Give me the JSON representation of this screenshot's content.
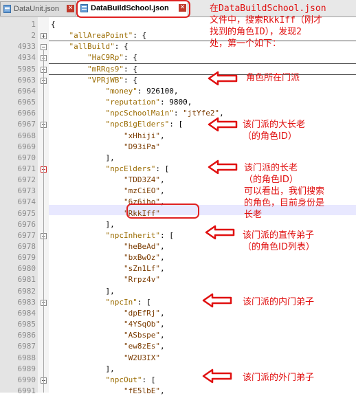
{
  "tabs": [
    {
      "label": "DataUnit.json",
      "active": false
    },
    {
      "label": "DataBuildSchool.json",
      "active": true
    }
  ],
  "lines": [
    {
      "n": "1",
      "text": "{"
    },
    {
      "n": "2",
      "text": "    \"allAreaPoint\": {"
    },
    {
      "n": "4933",
      "text": "    \"allBuild\": {"
    },
    {
      "n": "4934",
      "text": "        \"HaC9Rp\": {"
    },
    {
      "n": "5985",
      "text": "        \"mRRqs9\": {"
    },
    {
      "n": "6963",
      "text": "        \"VPRjWB\": {"
    },
    {
      "n": "6964",
      "text": "            \"money\": 926100,"
    },
    {
      "n": "6965",
      "text": "            \"reputation\": 9800,"
    },
    {
      "n": "6966",
      "text": "            \"npcSchoolMain\": \"jtYfe2\","
    },
    {
      "n": "6967",
      "text": "            \"npcBigElders\": ["
    },
    {
      "n": "6968",
      "text": "                \"xHhiji\","
    },
    {
      "n": "6969",
      "text": "                \"D93iPa\""
    },
    {
      "n": "6970",
      "text": "            ],"
    },
    {
      "n": "6971",
      "text": "            \"npcElders\": ["
    },
    {
      "n": "6972",
      "text": "                \"TDD3Z4\","
    },
    {
      "n": "6973",
      "text": "                \"mzCiEO\","
    },
    {
      "n": "6974",
      "text": "                \"6z6iho\","
    },
    {
      "n": "6975",
      "text": "                \"RkkIff\""
    },
    {
      "n": "6976",
      "text": "            ],"
    },
    {
      "n": "6977",
      "text": "            \"npcInherit\": ["
    },
    {
      "n": "6978",
      "text": "                \"heBeAd\","
    },
    {
      "n": "6979",
      "text": "                \"bxBwOz\","
    },
    {
      "n": "6980",
      "text": "                \"sZn1Lf\","
    },
    {
      "n": "6981",
      "text": "                \"Rrpz4v\""
    },
    {
      "n": "6982",
      "text": "            ],"
    },
    {
      "n": "6983",
      "text": "            \"npcIn\": ["
    },
    {
      "n": "6984",
      "text": "                \"dpEfRj\","
    },
    {
      "n": "6985",
      "text": "                \"4YSqOb\","
    },
    {
      "n": "6986",
      "text": "                \"ASbspe\","
    },
    {
      "n": "6987",
      "text": "                \"ew8zEs\","
    },
    {
      "n": "6988",
      "text": "                \"W2U3IX\""
    },
    {
      "n": "6989",
      "text": "            ],"
    },
    {
      "n": "6990",
      "text": "            \"npcOut\": ["
    },
    {
      "n": "6991",
      "text": "                \"fE5lbE\","
    }
  ],
  "annotations": {
    "intro": "在DataBuildSchool.json\n文件中，搜索RkkIff（刚才\n找到的角色ID），发现2\n处，第一个如下：",
    "school": "角色所在门派",
    "big_elders": "该门派的大长老\n（的角色ID）",
    "elders": "该门派的长老\n（的角色ID）\n可以看出，我们搜索\n的角色，目前身份是\n长老",
    "inherit": "该门派的直传弟子\n（的角色ID列表）",
    "inner": "该门派的内门弟子",
    "outer": "该门派的外门弟子"
  },
  "colors": {
    "annotation": "#e01010",
    "key": "#9a6b00",
    "highlight_line": "#e8e8ff"
  }
}
